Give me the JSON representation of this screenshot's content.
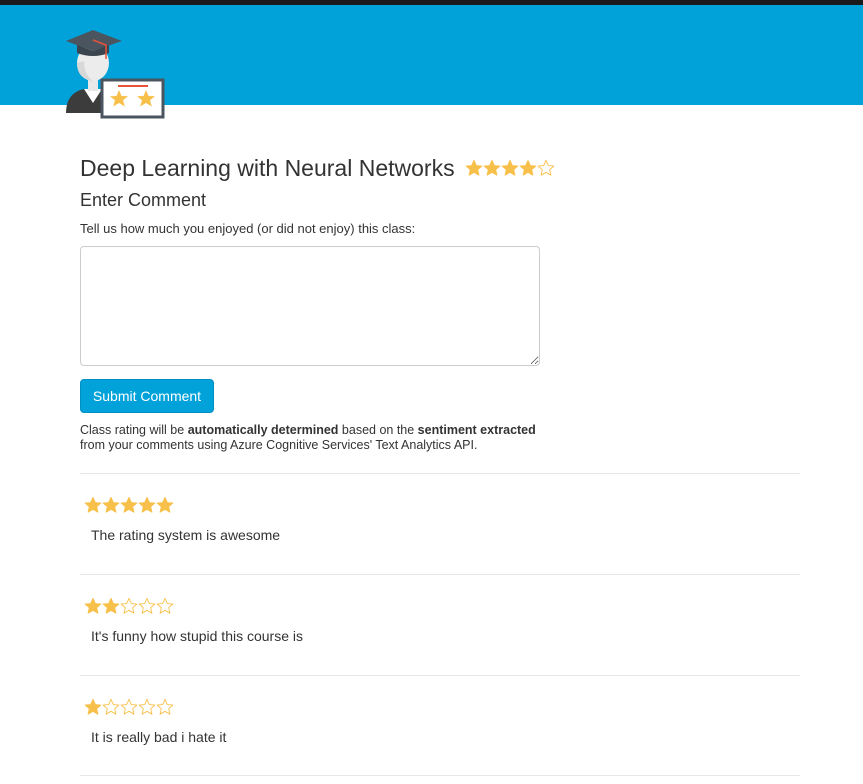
{
  "header": {
    "logo_icon": "graduate-rating-logo-icon",
    "band_color": "#00a2d9"
  },
  "course": {
    "title": "Deep Learning with Neural Networks",
    "rating": 4,
    "max_rating": 5
  },
  "form": {
    "heading": "Enter Comment",
    "prompt": "Tell us how much you enjoyed (or did not enjoy) this class:",
    "comment_value": "",
    "submit_label": "Submit Comment"
  },
  "info": {
    "part1": "Class rating will be ",
    "bold1": "automatically determined",
    "part2": " based on the ",
    "bold2": "sentiment extracted",
    "part3": "from your comments using Azure Cognitive Services' Text Analytics API."
  },
  "comments": [
    {
      "rating": 5,
      "text": "The rating system is awesome"
    },
    {
      "rating": 2,
      "text": "It's funny how stupid this course is"
    },
    {
      "rating": 1,
      "text": "It is really bad i hate it"
    }
  ],
  "colors": {
    "accent": "#00a2d9",
    "star_filled": "#f7c04a",
    "star_empty_stroke": "#f7c04a"
  }
}
